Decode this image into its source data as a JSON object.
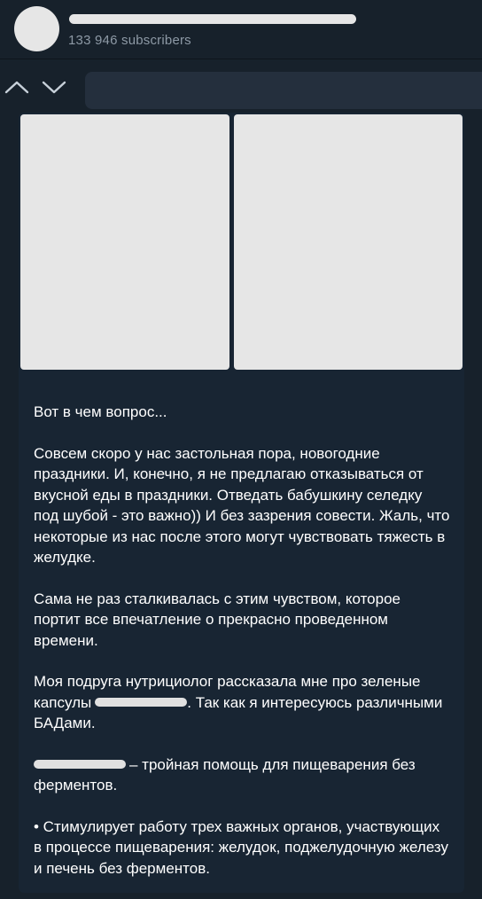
{
  "channel": {
    "subscribers": "133 946 subscribers"
  },
  "nav": {
    "up_icon": "chevron-up-icon",
    "down_icon": "chevron-down-icon"
  },
  "post": {
    "line1": "Вот в чем вопрос...",
    "para1": "Совсем скоро у нас застольная пора, новогодние праздники. И, конечно, я не предлагаю отказываться от вкусной еды в праздники. Отведать бабушкину селедку под шубой - это важно)) И без зазрения совести. Жаль, что некоторые из нас после этого могут чувствовать тяжесть в желудке.",
    "para2": "Сама не раз сталкивалась с этим чувством, которое портит все впечатление о прекрасно проведенном времени.",
    "para3_before": "Моя подруга нутрициолог рассказала мне про зеленые капсулы",
    "para3_after": ". Так как я интересуюсь различными БАДами.",
    "para4_after": "– тройная помощь для пищеварения без ферментов.",
    "bullet1": "• Стимулирует работу трех важных органов, участвующих в процессе пищеварения: желудок, поджелудочную железу и печень без ферментов."
  },
  "colors": {
    "background": "#17212b",
    "bubble": "#182533",
    "search": "#242f3d",
    "muted_text": "#8d99a5",
    "redaction": "#e6e6e6"
  }
}
